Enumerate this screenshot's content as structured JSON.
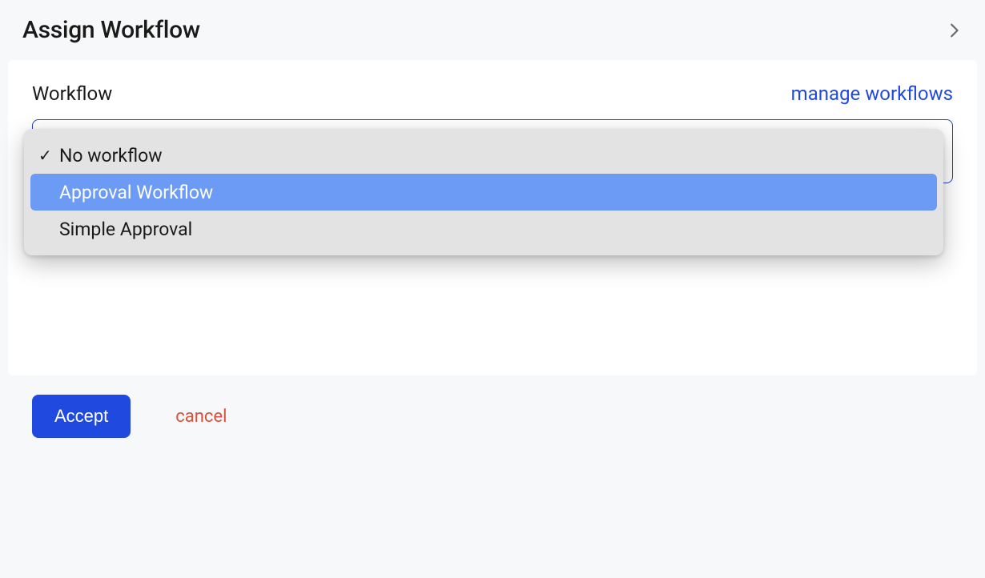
{
  "header": {
    "title": "Assign Workflow"
  },
  "form": {
    "field_label": "Workflow",
    "manage_link": "manage workflows"
  },
  "dropdown": {
    "options": [
      {
        "label": "No workflow",
        "selected": true,
        "highlighted": false
      },
      {
        "label": "Approval Workflow",
        "selected": false,
        "highlighted": true
      },
      {
        "label": "Simple Approval",
        "selected": false,
        "highlighted": false
      }
    ]
  },
  "footer": {
    "accept_label": "Accept",
    "cancel_label": "cancel"
  }
}
